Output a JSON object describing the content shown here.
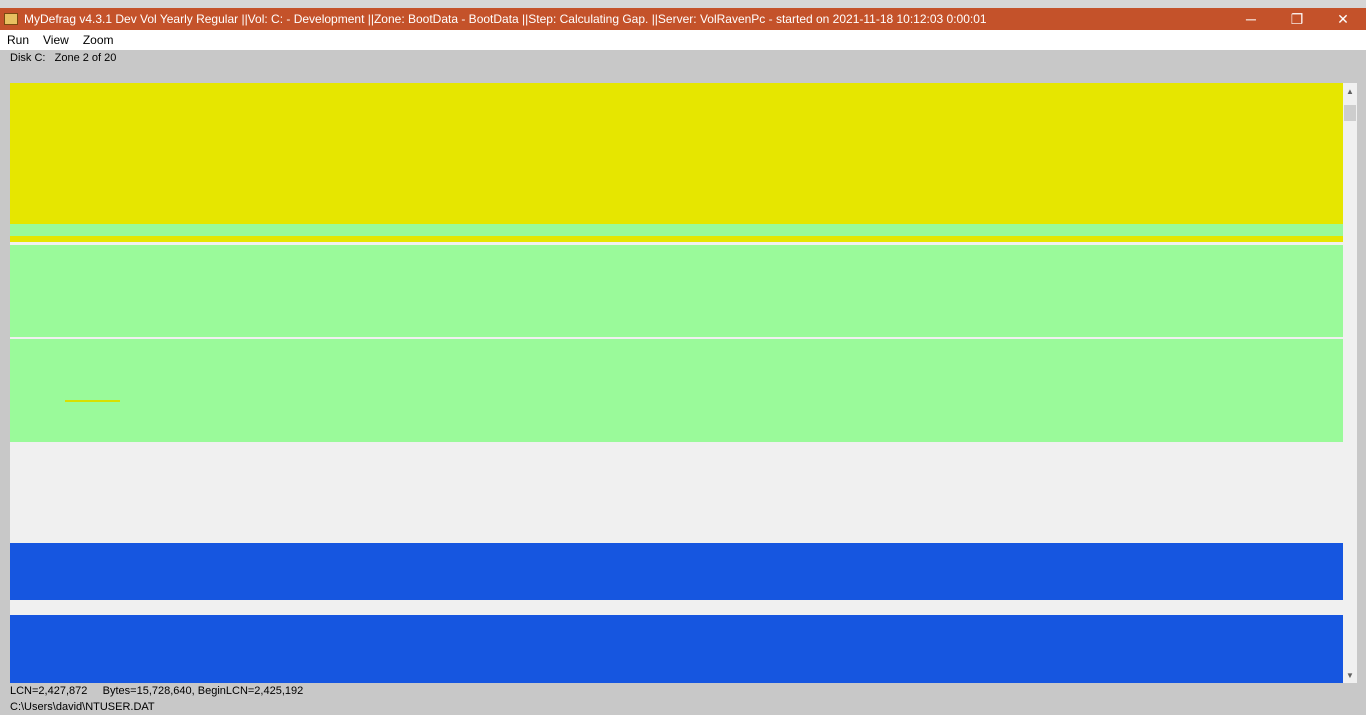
{
  "window": {
    "title": "MyDefrag v4.3.1   Dev Vol Yearly Regular ||Vol: C: - Development ||Zone: BootData - BootData ||Step: Calculating Gap. ||Server: VolRavenPc -  started on 2021-11-18 10:12:03 0:00:01",
    "minimize_glyph": "─",
    "restore_glyph": "❐",
    "close_glyph": "✕"
  },
  "menu": {
    "items": [
      "Run",
      "View",
      "Zoom"
    ]
  },
  "info": {
    "disk": "Disk C:",
    "zone": "Zone 2 of 20"
  },
  "status": {
    "line1": "LCN=2,427,872     Bytes=15,728,640, BeginLCN=2,425,192",
    "line2": "C:\\Users\\david\\NTUSER.DAT"
  },
  "legend_colors": {
    "used_unmovable": "#e6e600",
    "used_movable": "#9afa9a",
    "free": "#f0f0f0",
    "fragmented": "#1656e0"
  }
}
